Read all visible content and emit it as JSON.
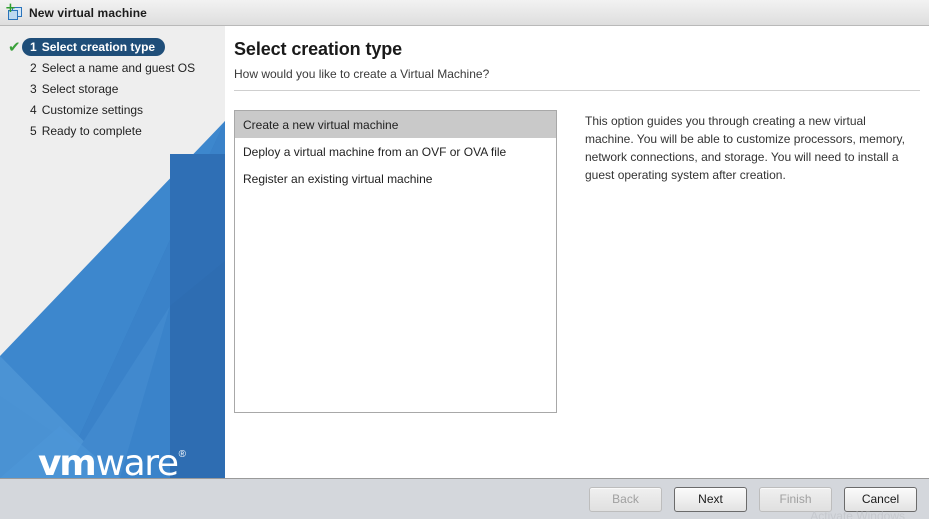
{
  "window": {
    "title": "New virtual machine",
    "icon": "new-vm-icon"
  },
  "sidebar": {
    "logo_part1": "vm",
    "logo_part2": "ware",
    "logo_trademark": "®",
    "steps": [
      {
        "num": "1",
        "label": "Select creation type",
        "active": true,
        "completed": true
      },
      {
        "num": "2",
        "label": "Select a name and guest OS",
        "active": false,
        "completed": false
      },
      {
        "num": "3",
        "label": "Select storage",
        "active": false,
        "completed": false
      },
      {
        "num": "4",
        "label": "Customize settings",
        "active": false,
        "completed": false
      },
      {
        "num": "5",
        "label": "Ready to complete",
        "active": false,
        "completed": false
      }
    ],
    "check_glyph": "✔",
    "colors": {
      "panel_top": "#eeeeee",
      "blue_primary": "#3276c3",
      "blue_dark": "#2f6fb5",
      "active_pill": "#1f4e79",
      "check_green": "#3aa13a"
    }
  },
  "main": {
    "title": "Select creation type",
    "subtitle": "How would you like to create a Virtual Machine?",
    "options": [
      {
        "label": "Create a new virtual machine",
        "selected": true
      },
      {
        "label": "Deploy a virtual machine from an OVF or OVA file",
        "selected": false
      },
      {
        "label": "Register an existing virtual machine",
        "selected": false
      }
    ],
    "description": "This option guides you through creating a new virtual machine. You will be able to customize processors, memory, network connections, and storage. You will need to install a guest operating system after creation."
  },
  "footer": {
    "buttons": [
      {
        "label": "Back",
        "enabled": false,
        "emphasis": false
      },
      {
        "label": "Next",
        "enabled": true,
        "emphasis": true
      },
      {
        "label": "Finish",
        "enabled": false,
        "emphasis": false
      },
      {
        "label": "Cancel",
        "enabled": true,
        "emphasis": true
      }
    ],
    "watermark": "Activate Windows"
  }
}
